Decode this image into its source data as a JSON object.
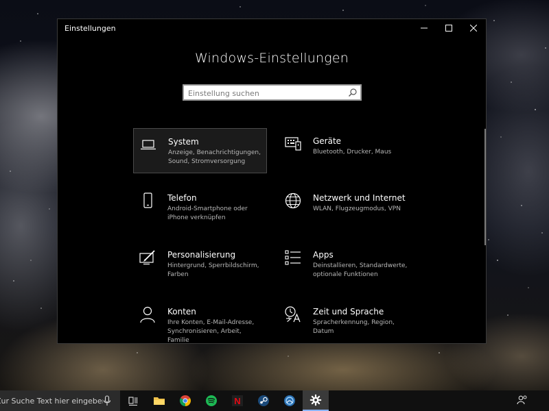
{
  "window": {
    "title": "Einstellungen",
    "heading": "Windows-Einstellungen"
  },
  "search": {
    "placeholder": "Einstellung suchen"
  },
  "categories": [
    {
      "name": "System",
      "description": "Anzeige, Benachrichtigungen, Sound, Stromversorgung",
      "icon": "laptop-icon",
      "selected": true
    },
    {
      "name": "Geräte",
      "description": "Bluetooth, Drucker, Maus",
      "icon": "keyboard-devices-icon"
    },
    {
      "name": "Telefon",
      "description": "Android-Smartphone oder iPhone verknüpfen",
      "icon": "phone-icon"
    },
    {
      "name": "Netzwerk und Internet",
      "description": "WLAN, Flugzeugmodus, VPN",
      "icon": "globe-icon"
    },
    {
      "name": "Personalisierung",
      "description": "Hintergrund, Sperrbildschirm, Farben",
      "icon": "paint-brush-icon"
    },
    {
      "name": "Apps",
      "description": "Deinstallieren, Standardwerte, optionale Funktionen",
      "icon": "apps-list-icon"
    },
    {
      "name": "Konten",
      "description": "Ihre Konten, E-Mail-Adresse, Synchronisieren, Arbeit, Familie",
      "icon": "person-icon"
    },
    {
      "name": "Zeit und Sprache",
      "description": "Spracherkennung, Region, Datum",
      "icon": "time-language-icon"
    }
  ],
  "taskbar": {
    "search_placeholder": "Zur Suche Text hier eingeben",
    "apps": [
      "task-view-icon",
      "file-explorer-icon",
      "chrome-icon",
      "spotify-icon",
      "netflix-icon",
      "steam-icon",
      "app-icon",
      "settings-gear-icon"
    ],
    "netflix_letter": "N"
  },
  "colors": {
    "window_bg": "#000000",
    "accent_highlight": "#1b1b1b",
    "spotify": "#1db954",
    "netflix": "#e50914",
    "chrome_red": "#db4437",
    "chrome_yellow": "#f4b400",
    "chrome_green": "#0f9d58",
    "chrome_blue": "#4285f4",
    "folder": "#f0c24b"
  }
}
